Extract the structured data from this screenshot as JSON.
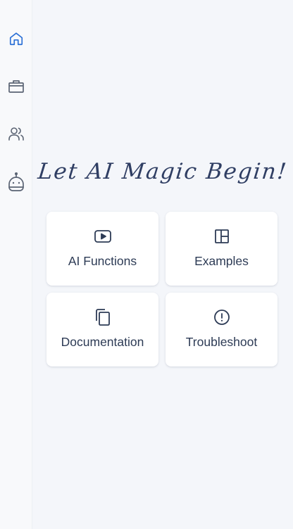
{
  "sidebar": {
    "items": [
      {
        "icon": "home-icon",
        "active": true
      },
      {
        "icon": "briefcase-icon",
        "active": false
      },
      {
        "icon": "users-icon",
        "active": false
      },
      {
        "icon": "robot-icon",
        "active": false
      }
    ],
    "active_color": "#2a6fd6",
    "inactive_color": "#5b6474"
  },
  "hero": {
    "title": "Let AI Magic Begin!"
  },
  "cards": [
    {
      "label": "AI Functions",
      "icon": "play-video-icon"
    },
    {
      "label": "Examples",
      "icon": "layout-panels-icon"
    },
    {
      "label": "Documentation",
      "icon": "copy-documents-icon"
    },
    {
      "label": "Troubleshoot",
      "icon": "alert-circle-icon"
    }
  ]
}
